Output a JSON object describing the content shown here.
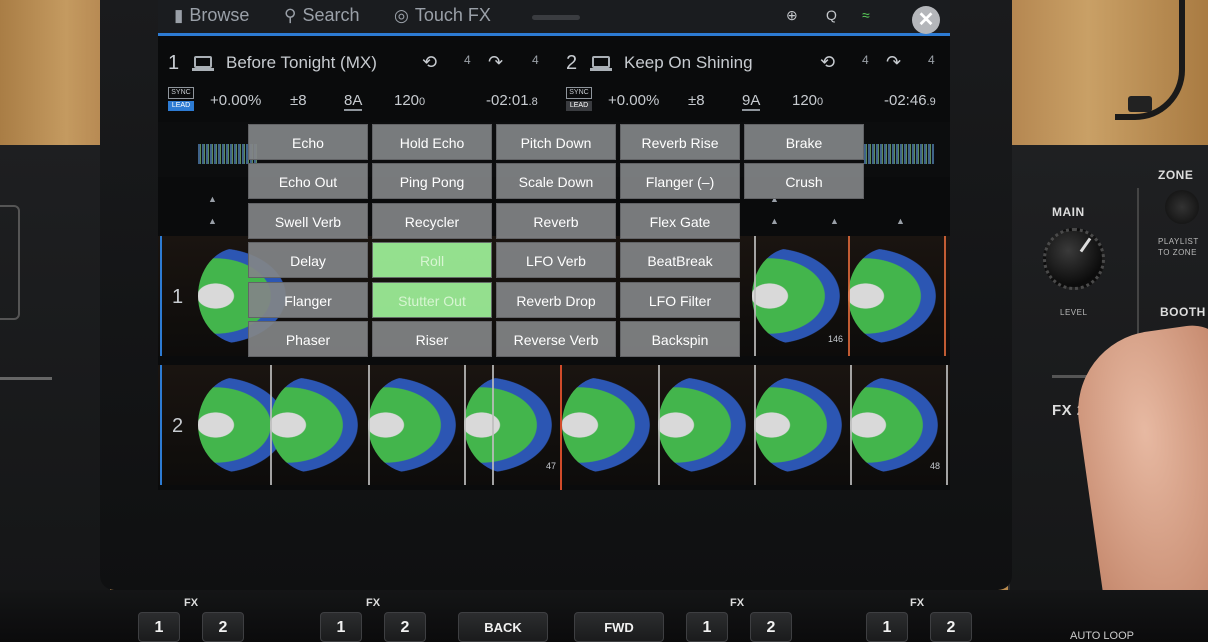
{
  "topbar": {
    "browse_label": "Browse",
    "search_label": "Search",
    "touchfx_label": "Touch FX",
    "q_label": "Q",
    "close_label": "✕"
  },
  "decks": [
    {
      "number": "1",
      "title": "Before Tonight (MX)",
      "loop_count": "4",
      "jump_count": "4",
      "sync": "SYNC",
      "lead": "LEAD",
      "pitch": "+0.00%",
      "range": "±8",
      "key": "8A",
      "bpm": "120",
      "bpm_decimal": "0",
      "time": "-02:01",
      "time_decimal": ".8"
    },
    {
      "number": "2",
      "title": "Keep On Shining",
      "loop_count": "4",
      "jump_count": "4",
      "sync": "SYNC",
      "lead": "LEAD",
      "pitch": "+0.00%",
      "range": "±8",
      "key": "9A",
      "bpm": "120",
      "bpm_decimal": "0",
      "time": "-02:46",
      "time_decimal": ".9"
    }
  ],
  "lanes": [
    {
      "label": "1",
      "bar_number": "146"
    },
    {
      "label": "2",
      "bar_number_a": "47",
      "bar_number_b": "48"
    }
  ],
  "fx_grid": {
    "columns": [
      [
        "Echo",
        "Echo Out",
        "Swell Verb",
        "Delay",
        "Flanger",
        "Phaser"
      ],
      [
        "Hold Echo",
        "Ping Pong",
        "Recycler",
        "Roll",
        "Stutter Out",
        "Riser"
      ],
      [
        "Pitch Down",
        "Scale Down",
        "Reverb",
        "LFO Verb",
        "Reverb Drop",
        "Reverse Verb"
      ],
      [
        "Reverb Rise",
        "Flanger (–)",
        "Flex Gate",
        "BeatBreak",
        "LFO Filter",
        "Backspin"
      ],
      [
        "Brake",
        "Crush"
      ]
    ],
    "active": [
      "Roll",
      "Stutter Out"
    ]
  },
  "hardware": {
    "zone": "ZONE",
    "main": "MAIN",
    "level": "LEVEL",
    "playlist": "PLAYLIST TO ZONE",
    "booth": "BOOTH",
    "fx2": "FX 2",
    "fx_small": "FX",
    "btn1": "1",
    "btn2": "2",
    "back": "BACK",
    "fwd": "FWD",
    "auto_loop": "AUTO LOOP"
  },
  "colors": {
    "accent": "#2d7bd3",
    "wave_green": "#43b54c",
    "wave_blue": "#2c56b3",
    "fx_button": "#828487",
    "fx_active": "#9beb96"
  }
}
